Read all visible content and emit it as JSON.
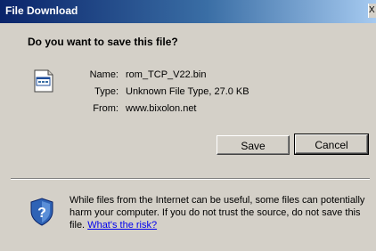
{
  "window": {
    "title": "File Download",
    "close_glyph": "X"
  },
  "dialog": {
    "question": "Do you want to save this file?",
    "file_icon": "document-icon",
    "info": {
      "name_label": "Name:",
      "name_value": "rom_TCP_V22.bin",
      "type_label": "Type:",
      "type_value": "Unknown File Type, 27.0 KB",
      "from_label": "From:",
      "from_value": "www.bixolon.net"
    },
    "buttons": {
      "save": "Save",
      "cancel": "Cancel"
    },
    "warning": {
      "icon": "shield-icon",
      "text": "While files from the Internet can be useful, some files can potentially harm your computer. If you do not trust the source, do not save this file.",
      "link": "What's the risk?"
    }
  },
  "colors": {
    "title_start": "#0a246a",
    "title_end": "#a6caf0",
    "dialog_bg": "#d4d0c8",
    "link": "#0000ee"
  }
}
